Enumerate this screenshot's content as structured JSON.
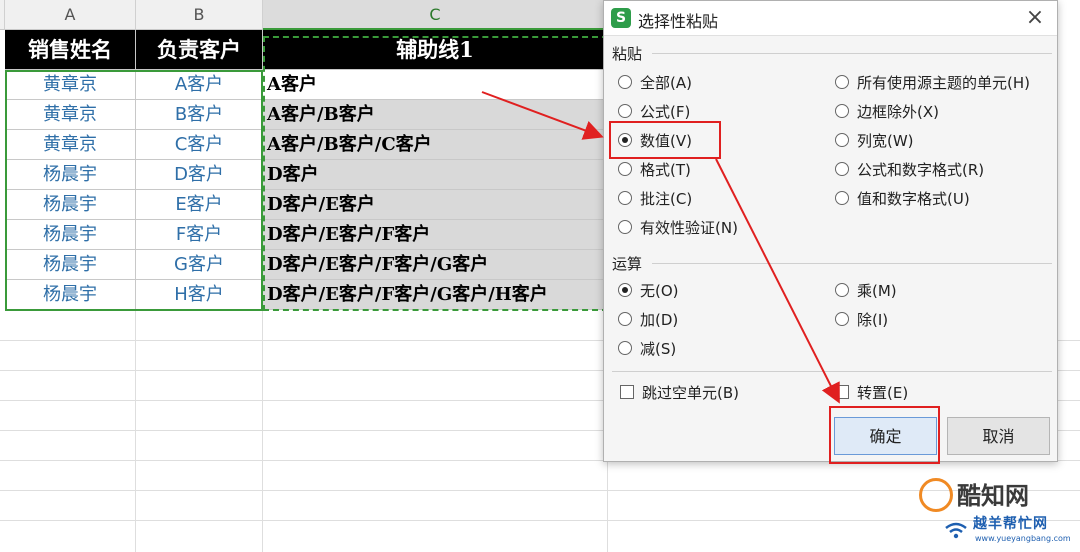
{
  "sheet": {
    "columns": [
      "A",
      "B",
      "C"
    ],
    "header": {
      "a": "销售姓名",
      "b": "负责客户",
      "c": "辅助线1"
    },
    "rows": [
      {
        "a": "黄章京",
        "b": "A客户",
        "c": "A客户"
      },
      {
        "a": "黄章京",
        "b": "B客户",
        "c": "A客户/B客户"
      },
      {
        "a": "黄章京",
        "b": "C客户",
        "c": "A客户/B客户/C客户"
      },
      {
        "a": "杨晨宇",
        "b": "D客户",
        "c": "D客户"
      },
      {
        "a": "杨晨宇",
        "b": "E客户",
        "c": "D客户/E客户"
      },
      {
        "a": "杨晨宇",
        "b": "F客户",
        "c": "D客户/E客户/F客户"
      },
      {
        "a": "杨晨宇",
        "b": "G客户",
        "c": "D客户/E客户/F客户/G客户"
      },
      {
        "a": "杨晨宇",
        "b": "H客户",
        "c": "D客户/E客户/F客户/G客户/H客户"
      }
    ]
  },
  "dialog": {
    "app_icon": "S",
    "title": "选择性粘贴",
    "close_icon": "×",
    "paste_section": "粘贴",
    "paste_options": [
      {
        "label": "全部(A)",
        "selected": false
      },
      {
        "label": "公式(F)",
        "selected": false
      },
      {
        "label": "数值(V)",
        "selected": true
      },
      {
        "label": "格式(T)",
        "selected": false
      },
      {
        "label": "批注(C)",
        "selected": false
      },
      {
        "label": "有效性验证(N)",
        "selected": false
      },
      {
        "label": "所有使用源主题的单元(H)",
        "selected": false
      },
      {
        "label": "边框除外(X)",
        "selected": false
      },
      {
        "label": "列宽(W)",
        "selected": false
      },
      {
        "label": "公式和数字格式(R)",
        "selected": false
      },
      {
        "label": "值和数字格式(U)",
        "selected": false
      }
    ],
    "operation_section": "运算",
    "operation_options": [
      {
        "label": "无(O)",
        "selected": true
      },
      {
        "label": "加(D)",
        "selected": false
      },
      {
        "label": "减(S)",
        "selected": false
      },
      {
        "label": "乘(M)",
        "selected": false
      },
      {
        "label": "除(I)",
        "selected": false
      }
    ],
    "skip_blanks": {
      "label": "跳过空单元(B)",
      "checked": false
    },
    "transpose": {
      "label": "转置(E)",
      "checked": false
    },
    "ok": "确定",
    "cancel": "取消"
  },
  "annotations": {
    "highlight_color": "#e02020"
  },
  "watermark": {
    "title": "酷知网",
    "subtitle": "越羊帮忙网",
    "url": "www.yueyangbang.com"
  }
}
